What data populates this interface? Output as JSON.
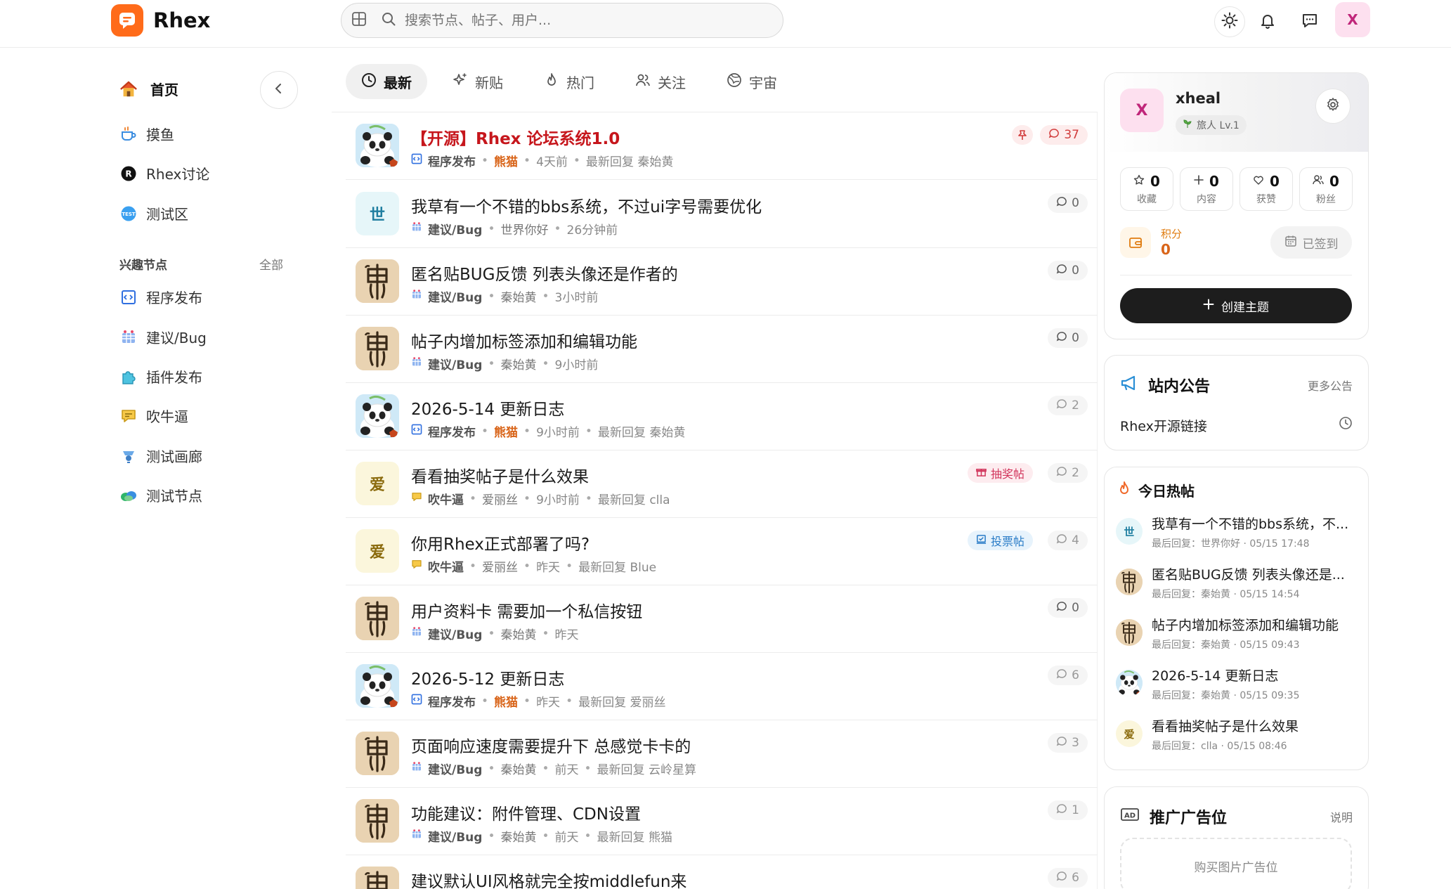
{
  "header": {
    "logo_text": "Rhex",
    "search_placeholder": "搜索节点、帖子、用户...",
    "avatar_letter": "X",
    "icons": [
      "grid-icon",
      "search-icon",
      "sun-icon",
      "bell-icon",
      "message-icon"
    ]
  },
  "sidebar": {
    "main_items": [
      {
        "label": "首页",
        "icon": "house-icon"
      },
      {
        "label": "摸鱼",
        "icon": "coffee-icon"
      },
      {
        "label": "Rhex讨论",
        "icon": "r-badge-icon"
      },
      {
        "label": "测试区",
        "icon": "test-badge-icon"
      }
    ],
    "section_title": "兴趣节点",
    "section_all": "全部",
    "node_items": [
      {
        "label": "程序发布",
        "icon": "code-icon"
      },
      {
        "label": "建议/Bug",
        "icon": "bug-icon"
      },
      {
        "label": "插件发布",
        "icon": "puzzle-icon"
      },
      {
        "label": "吹牛逼",
        "icon": "chat-icon"
      },
      {
        "label": "测试画廊",
        "icon": "gallery-icon"
      },
      {
        "label": "测试节点",
        "icon": "cloud-icon"
      }
    ]
  },
  "tabs": [
    {
      "label": "最新",
      "icon": "clock-icon",
      "active": true
    },
    {
      "label": "新贴",
      "icon": "sparkle-icon",
      "active": false
    },
    {
      "label": "热门",
      "icon": "flame-icon",
      "active": false
    },
    {
      "label": "关注",
      "icon": "users-icon",
      "active": false
    },
    {
      "label": "宇宙",
      "icon": "globe-icon",
      "active": false
    }
  ],
  "posts": [
    {
      "title": "【开源】Rhex 论坛系统1.0",
      "node": "程序发布",
      "author": "熊猫",
      "time": "4天前",
      "last_reply": "最新回复 秦始黄",
      "replies": "37",
      "avatar": "panda"
    },
    {
      "title": "我草有一个不错的bbs系统，不过ui字号需要优化",
      "node": "建议/Bug",
      "author": "世界你好",
      "time": "26分钟前",
      "last_reply": "",
      "replies": "0",
      "avatar": "世"
    },
    {
      "title": "匿名贴BUG反馈 列表头像还是作者的",
      "node": "建议/Bug",
      "author": "秦始黄",
      "time": "3小时前",
      "last_reply": "",
      "replies": "0",
      "avatar": "qin"
    },
    {
      "title": "帖子内增加标签添加和编辑功能",
      "node": "建议/Bug",
      "author": "秦始黄",
      "time": "9小时前",
      "last_reply": "",
      "replies": "0",
      "avatar": "qin"
    },
    {
      "title": "2026-5-14 更新日志",
      "node": "程序发布",
      "author": "熊猫",
      "time": "9小时前",
      "last_reply": "最新回复 秦始黄",
      "replies": "2",
      "avatar": "panda"
    },
    {
      "title": "看看抽奖帖子是什么效果",
      "node": "吹牛逼",
      "author": "爱丽丝",
      "time": "9小时前",
      "last_reply": "最新回复 clla",
      "replies": "2",
      "avatar": "爱",
      "tag": "抽奖帖"
    },
    {
      "title": "你用Rhex正式部署了吗?",
      "node": "吹牛逼",
      "author": "爱丽丝",
      "time": "昨天",
      "last_reply": "最新回复 Blue",
      "replies": "4",
      "avatar": "爱",
      "tag": "投票帖"
    },
    {
      "title": "用户资料卡 需要加一个私信按钮",
      "node": "建议/Bug",
      "author": "秦始黄",
      "time": "昨天",
      "last_reply": "",
      "replies": "0",
      "avatar": "qin"
    },
    {
      "title": "2026-5-12 更新日志",
      "node": "程序发布",
      "author": "熊猫",
      "time": "昨天",
      "last_reply": "最新回复 爱丽丝",
      "replies": "6",
      "avatar": "panda"
    },
    {
      "title": "页面响应速度需要提升下 总感觉卡卡的",
      "node": "建议/Bug",
      "author": "秦始黄",
      "time": "前天",
      "last_reply": "最新回复 云岭星算",
      "replies": "3",
      "avatar": "qin"
    },
    {
      "title": "功能建议：附件管理、CDN设置",
      "node": "建议/Bug",
      "author": "秦始黄",
      "time": "前天",
      "last_reply": "最新回复 熊猫",
      "replies": "1",
      "avatar": "qin"
    },
    {
      "title": "建议默认UI风格就完全按middlefun来",
      "node": "",
      "author": "",
      "time": "",
      "last_reply": "",
      "replies": "6",
      "avatar": "qin"
    }
  ],
  "profile": {
    "avatar_letter": "X",
    "name": "xheal",
    "level": "旅人 Lv.1",
    "stats": [
      {
        "label": "收藏",
        "value": "0",
        "icon": "star-icon"
      },
      {
        "label": "内容",
        "value": "0",
        "icon": "plus-icon"
      },
      {
        "label": "获赞",
        "value": "0",
        "icon": "heart-icon"
      },
      {
        "label": "粉丝",
        "value": "0",
        "icon": "user-icon"
      }
    ],
    "points_label": "积分",
    "points_value": "0",
    "signed_label": "已签到",
    "create_label": "创建主题"
  },
  "notice": {
    "title": "站内公告",
    "more": "更多公告",
    "item": "Rhex开源链接"
  },
  "hot": {
    "title": "今日热帖",
    "items": [
      {
        "title": "我草有一个不错的bbs系统，不...",
        "meta": "最后回复：世界你好 · 05/15 17:48",
        "avatar": "世"
      },
      {
        "title": "匿名贴BUG反馈 列表头像还是...",
        "meta": "最后回复：秦始黄 · 05/15 14:54",
        "avatar": "qin"
      },
      {
        "title": "帖子内增加标签添加和编辑功能",
        "meta": "最后回复：秦始黄 · 05/15 09:43",
        "avatar": "qin"
      },
      {
        "title": "2026-5-14 更新日志",
        "meta": "最后回复：秦始黄 · 05/15 09:35",
        "avatar": "panda"
      },
      {
        "title": "看看抽奖帖子是什么效果",
        "meta": "最后回复：clla · 05/15 08:46",
        "avatar": "爱"
      }
    ]
  },
  "ad": {
    "title": "推广广告位",
    "more": "说明",
    "box": "购买图片广告位"
  },
  "colors": {
    "brand": "#ff6b1a",
    "pinned_title": "#c6161c",
    "hot_author": "#d9651a",
    "avatar_pink": "#fde0ef",
    "primary_button": "#1d1d1d"
  }
}
